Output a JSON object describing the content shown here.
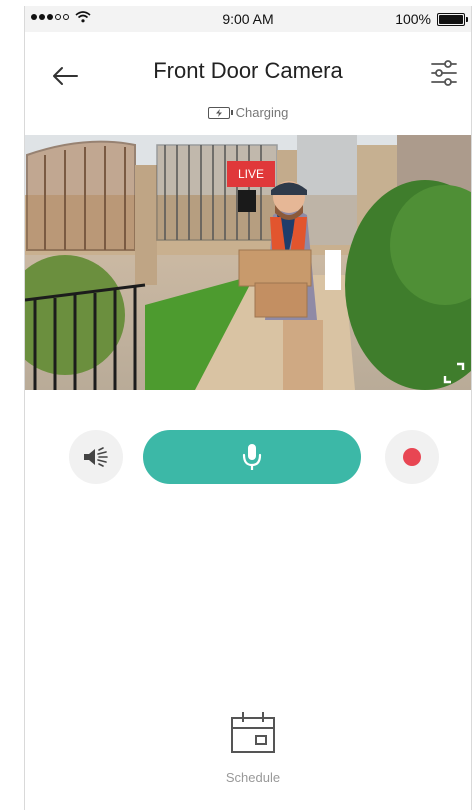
{
  "status_bar": {
    "time": "9:00 AM",
    "battery_text": "100%",
    "battery_level": 1.0,
    "signal_bars_filled": 3,
    "signal_bars_total": 5,
    "wifi_icon": "wifi-icon"
  },
  "header": {
    "title": "Front Door Camera",
    "back_icon": "arrow-left-icon",
    "settings_icon": "sliders-icon"
  },
  "device_status": {
    "text": "Charging",
    "icon": "battery-charging-icon"
  },
  "video": {
    "live_label": "LIVE",
    "fullscreen_icon": "fullscreen-icon"
  },
  "controls": {
    "speaker_icon": "speaker-voice-icon",
    "mic_icon": "microphone-icon",
    "record_icon": "record-dot-icon",
    "accent_color": "#3cb8a7",
    "record_color": "#e84653"
  },
  "bottom": {
    "schedule_label": "Schedule",
    "schedule_icon": "calendar-icon"
  }
}
